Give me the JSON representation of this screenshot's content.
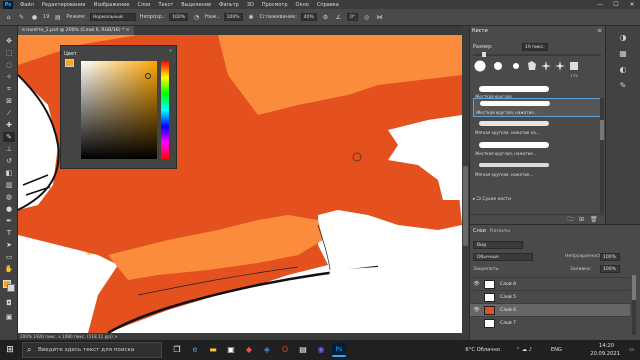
{
  "menubar": {
    "logo": "Ps",
    "items": [
      "Файл",
      "Редактирование",
      "Изображение",
      "Слои",
      "Текст",
      "Выделение",
      "Фильтр",
      "3D",
      "Просмотр",
      "Окно",
      "Справка"
    ],
    "controls": [
      "—",
      "☐",
      "✕"
    ]
  },
  "options": {
    "size_value": "19",
    "mode_label": "Режим:",
    "mode_value": "Нормальный",
    "opacity_label": "Непрозр.:",
    "opacity_value": "100%",
    "flow_label": "Наж.:",
    "flow_value": "100%",
    "smoothing_label": "Сглаживание:",
    "smoothing_value": "40%",
    "angle_value": "0°"
  },
  "document": {
    "tab_title": "я попёте_1.psd @ 200% (Слой 6, RGB/16) *",
    "tab_close": "×"
  },
  "color_panel": {
    "title": "Цвет",
    "close": "«",
    "fg_color": "#f5a623"
  },
  "status": {
    "text": "200%    1920 пикс. x 1080 пикс. (118,11 ppi)    >"
  },
  "brushes": {
    "tab": "Кисти",
    "menu": "≡",
    "size_label": "Размер:",
    "size_value": "19 пикс.",
    "presets": [
      "",
      "",
      "",
      "",
      "",
      "",
      "175"
    ],
    "rows": [
      {
        "name": "Жесткая круглая"
      },
      {
        "name": "Жесткая круглая, нажатие..."
      },
      {
        "name": "Мягкая круглая, нажатие на..."
      },
      {
        "name": "Жесткая круглая, нажатие..."
      },
      {
        "name": "Мягкая круглая, нажатие..."
      }
    ],
    "group": "Сухие кисти"
  },
  "layers": {
    "tab_layers": "Слои",
    "tab_channels": "Каналы",
    "filter": "Вид",
    "blend_mode": "Обычные",
    "opacity_label": "Непрозрачность:",
    "opacity_value": "100%",
    "lock_label": "Закрепить:",
    "fill_label": "Заливка:",
    "fill_value": "100%",
    "items": [
      {
        "name": "Слой 8"
      },
      {
        "name": "Слой 5"
      },
      {
        "name": "Слой 6"
      },
      {
        "name": "Слой 7"
      }
    ]
  },
  "taskbar": {
    "search_placeholder": "Введите здесь текст для поиска",
    "weather": "6°C  Облачно",
    "time": "14:20",
    "date": "20.09.2021",
    "lang": "ENG"
  },
  "colors": {
    "orange_dark": "#e4501e",
    "orange_light": "#fb8c3c",
    "yellow": "#ffc35a",
    "accent_blue": "#5a9fd8"
  }
}
